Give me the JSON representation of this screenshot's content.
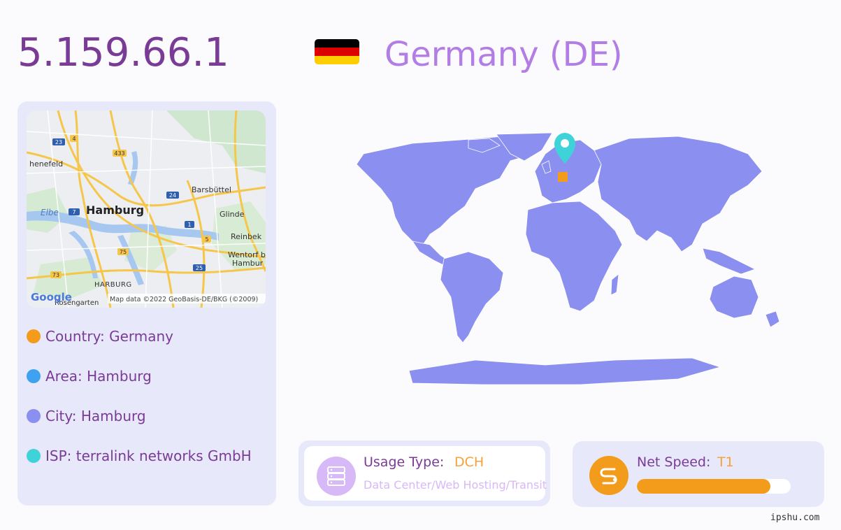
{
  "header": {
    "ip": "5.159.66.1",
    "country_title": "Germany (DE)",
    "flag_colors": [
      "#000000",
      "#dd0000",
      "#ffce00"
    ]
  },
  "map": {
    "labels": {
      "city": "Hamburg",
      "river": "Elbe",
      "north_west": "henefeld",
      "barsbuttel": "Barsbüttel",
      "glinde": "Glinde",
      "reinbek": "Reinbek",
      "wentorf": "Wentorf b",
      "hamburg_small": "Hambur",
      "harburg": "HARBURG",
      "rosengarten": "Rosengarten"
    },
    "road_badges": [
      "23",
      "4",
      "433",
      "24",
      "7",
      "1",
      "5",
      "75",
      "73",
      "25"
    ],
    "logo": "Google",
    "attribution": "Map data ©2022 GeoBasis-DE/BKG (©2009)"
  },
  "info": {
    "country": "Country: Germany",
    "area": "Area: Hamburg",
    "city": "City: Hamburg",
    "isp": "ISP: terralink networks GmbH",
    "dot_colors": [
      "#f39c1b",
      "#3fa2f0",
      "#8a8ff0",
      "#3ed3d9"
    ]
  },
  "usage": {
    "label": "Usage Type:",
    "value": "DCH",
    "description": "Data Center/Web Hosting/Transit",
    "icon": "server-icon"
  },
  "speed": {
    "label": "Net Speed:",
    "value": "T1",
    "level_percent": 87,
    "icon": "speed-icon"
  },
  "watermark": "ipshu.com",
  "colors": {
    "accent_purple": "#7a3b96",
    "light_purple": "#b27ee6",
    "panel": "#e7e9fb",
    "map_fill": "#8a8ff0",
    "pin": "#3ed3d9",
    "highlight": "#f39c1b"
  }
}
